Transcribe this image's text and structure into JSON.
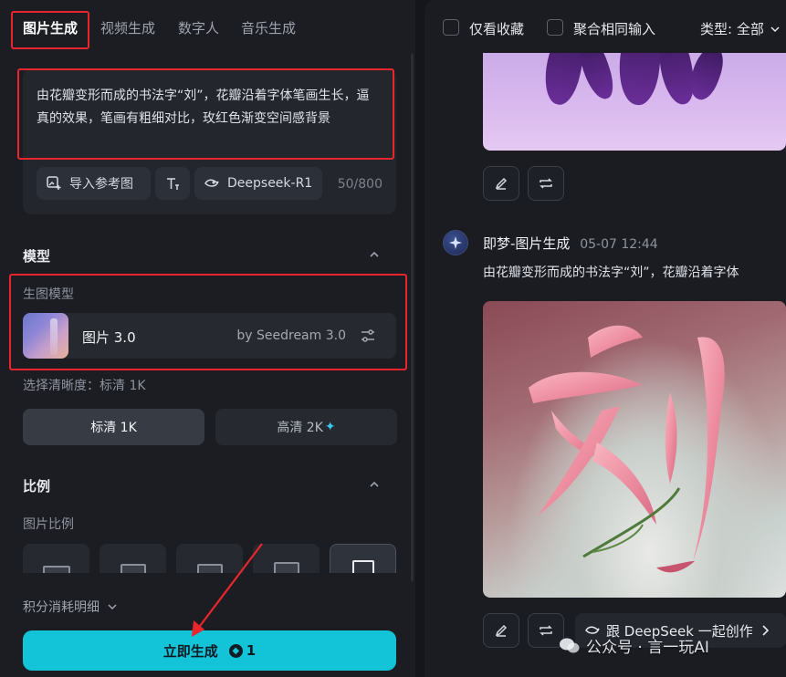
{
  "tabs": [
    {
      "label": "图片生成",
      "active": true
    },
    {
      "label": "视频生成",
      "active": false
    },
    {
      "label": "数字人",
      "active": false
    },
    {
      "label": "音乐生成",
      "active": false
    }
  ],
  "prompt": {
    "text": "由花瓣变形而成的书法字“刘”，花瓣沿着字体笔画生长，逼真的效果，笔画有粗细对比，玫红色渐变空间感背景",
    "import_ref_label": "导入参考图",
    "deepseek_label": "Deepseek-R1",
    "counter": "50/800"
  },
  "model_section": {
    "title": "模型",
    "sub_label": "生图模型",
    "model_name": "图片 3.0",
    "model_by": "by Seedream 3.0"
  },
  "resolution": {
    "label": "选择清晰度：标清 1K",
    "options": [
      "标清 1K",
      "高清 2K"
    ],
    "selected": "标清 1K",
    "hd_sparkle": "✦"
  },
  "ratio_section": {
    "title": "比例",
    "sub_label": "图片比例"
  },
  "cost_detail": "积分消耗明细",
  "generate": {
    "label": "立即生成",
    "cost": "1"
  },
  "right": {
    "filters": {
      "favorites": "仅看收藏",
      "merge": "聚合相同输入",
      "type": "类型: 全部"
    },
    "entry": {
      "source": "即梦-图片生成",
      "date": "05-07  12:44",
      "prompt": "由花瓣变形而成的书法字“刘”，花瓣沿着字体"
    },
    "main_image_text": "刘",
    "deepseek_chip": "跟 DeepSeek 一起创作"
  },
  "watermark": "公众号 · 言一玩AI",
  "colors": {
    "accent": "#13c4d8",
    "highlight": "#e8262b",
    "sparkle": "#39c8f0"
  }
}
